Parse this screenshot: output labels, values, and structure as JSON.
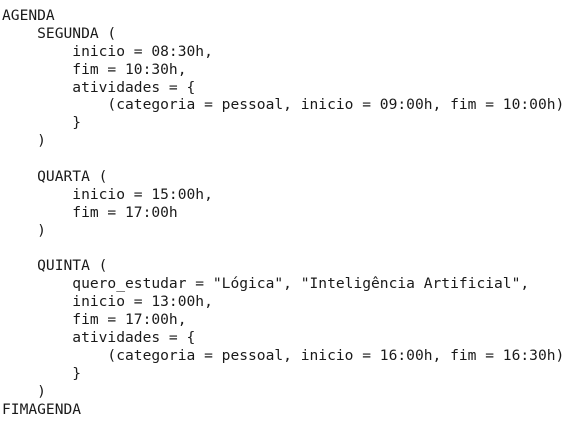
{
  "document": {
    "lines": [
      "AGENDA",
      "    SEGUNDA (",
      "        inicio = 08:30h,",
      "        fim = 10:30h,",
      "        atividades = {",
      "            (categoria = pessoal, inicio = 09:00h, fim = 10:00h)",
      "        }",
      "    )",
      "",
      "    QUARTA (",
      "        inicio = 15:00h,",
      "        fim = 17:00h",
      "    )",
      "",
      "    QUINTA (",
      "        quero_estudar = \"Lógica\", \"Inteligência Artificial\",",
      "        inicio = 13:00h,",
      "        fim = 17:00h,",
      "        atividades = {",
      "            (categoria = pessoal, inicio = 16:00h, fim = 16:30h)",
      "        }",
      "    )",
      "FIMAGENDA"
    ]
  }
}
